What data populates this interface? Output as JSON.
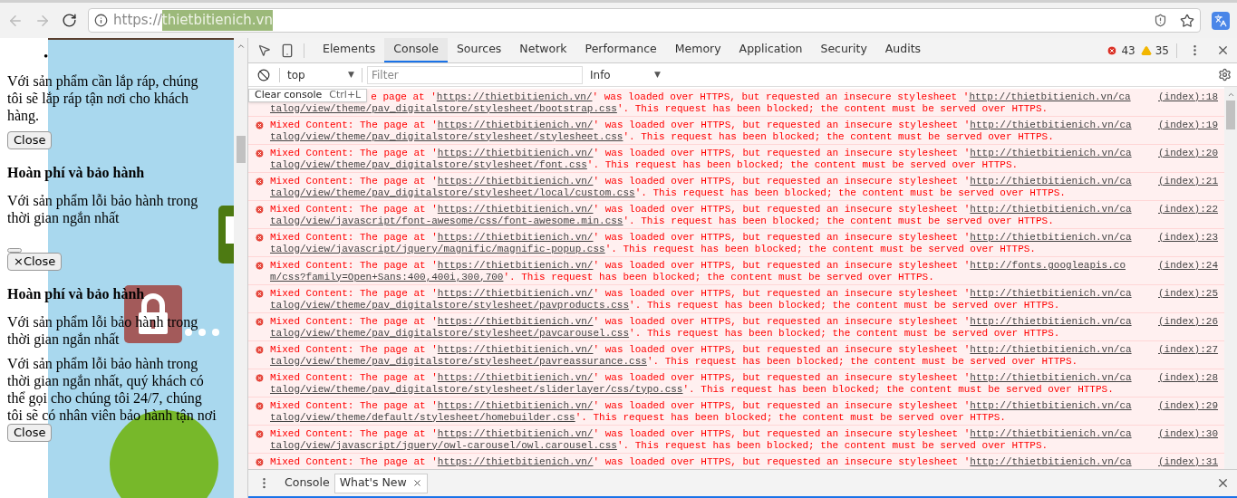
{
  "browser": {
    "url_scheme": "https://",
    "url_host": "thietbitienich.vn"
  },
  "page": {
    "blocks": [
      {
        "kind": "bullet",
        "text": "•"
      },
      {
        "kind": "para",
        "text": "Với sản phẩm cần lắp ráp, chúng tôi sẽ lắp ráp tận nơi cho khách hàng."
      },
      {
        "kind": "button",
        "text": "Close"
      },
      {
        "kind": "heading",
        "text": "Hoàn phí và bảo hành"
      },
      {
        "kind": "para",
        "text": "Với sản phẩm lỗi bảo hành trong thời gian ngắn nhất"
      },
      {
        "kind": "tiny_button"
      },
      {
        "kind": "button",
        "text": "×Close"
      },
      {
        "kind": "heading",
        "text": "Hoàn phí và bảo hành"
      },
      {
        "kind": "para",
        "text": "Với sản phẩm lỗi bảo hành trong thời gian ngắn nhất"
      },
      {
        "kind": "para_tight",
        "text": "Với sản phẩm lỗi bảo hành trong thời gian ngắn nhất, quý khách có thể gọi cho chúng tôi 24/7, chúng tôi sẽ có nhân viên bảo hành tận nơi"
      },
      {
        "kind": "button",
        "text": "Close"
      }
    ]
  },
  "devtools": {
    "tabs": [
      {
        "label": "Elements",
        "selected": false
      },
      {
        "label": "Console",
        "selected": true
      },
      {
        "label": "Sources",
        "selected": false
      },
      {
        "label": "Network",
        "selected": false
      },
      {
        "label": "Performance",
        "selected": false
      },
      {
        "label": "Memory",
        "selected": false
      },
      {
        "label": "Application",
        "selected": false
      },
      {
        "label": "Security",
        "selected": false
      },
      {
        "label": "Audits",
        "selected": false
      }
    ],
    "error_count": "43",
    "warning_count": "35",
    "context": "top",
    "filter_placeholder": "Filter",
    "level": "Info",
    "dropdown_caret": "▼",
    "tooltip": {
      "label": "Clear console",
      "shortcut": "Ctrl+L"
    },
    "messages": [
      {
        "before": "e page at '",
        "page_url": "https://thietbitienich.vn/",
        "middle": "' was loaded over HTTPS, but requested an insecure stylesheet '",
        "res_head": "http://thietbitienich.vn/ca",
        "res_tail": "talog/view/theme/pav_digitalstore/stylesheet/bootstrap.css",
        "after": "'. This request has been blocked; the content must be served over HTTPS.",
        "source": "(index):18",
        "covered": true
      },
      {
        "before": "Mixed Content: The page at '",
        "page_url": "https://thietbitienich.vn/",
        "middle": "' was loaded over HTTPS, but requested an insecure stylesheet '",
        "res_head": "http://thietbitienich.vn/ca",
        "res_tail": "talog/view/theme/pav_digitalstore/stylesheet/stylesheet.css",
        "after": "'. This request has been blocked; the content must be served over HTTPS.",
        "source": "(index):19",
        "covered": false
      },
      {
        "before": "Mixed Content: The page at '",
        "page_url": "https://thietbitienich.vn/",
        "middle": "' was loaded over HTTPS, but requested an insecure stylesheet '",
        "res_head": "http://thietbitienich.vn/ca",
        "res_tail": "talog/view/theme/pav_digitalstore/stylesheet/font.css",
        "after": "'. This request has been blocked; the content must be served over HTTPS.",
        "source": "(index):20",
        "covered": false
      },
      {
        "before": "Mixed Content: The page at '",
        "page_url": "https://thietbitienich.vn/",
        "middle": "' was loaded over HTTPS, but requested an insecure stylesheet '",
        "res_head": "http://thietbitienich.vn/ca",
        "res_tail": "talog/view/theme/pav_digitalstore/stylesheet/local/custom.css",
        "after": "'. This request has been blocked; the content must be served over HTTPS.",
        "source": "(index):21",
        "covered": false
      },
      {
        "before": "Mixed Content: The page at '",
        "page_url": "https://thietbitienich.vn/",
        "middle": "' was loaded over HTTPS, but requested an insecure stylesheet '",
        "res_head": "http://thietbitienich.vn/ca",
        "res_tail": "talog/view/javascript/font-awesome/css/font-awesome.min.css",
        "after": "'. This request has been blocked; the content must be served over HTTPS.",
        "source": "(index):22",
        "covered": false
      },
      {
        "before": "Mixed Content: The page at '",
        "page_url": "https://thietbitienich.vn/",
        "middle": "' was loaded over HTTPS, but requested an insecure stylesheet '",
        "res_head": "http://thietbitienich.vn/ca",
        "res_tail": "talog/view/javascript/jquery/magnific/magnific-popup.css",
        "after": "'. This request has been blocked; the content must be served over HTTPS.",
        "source": "(index):23",
        "covered": false
      },
      {
        "before": "Mixed Content: The page at '",
        "page_url": "https://thietbitienich.vn/",
        "middle": "' was loaded over HTTPS, but requested an insecure stylesheet '",
        "res_head": "http://fonts.googleapis.co",
        "res_tail": "m/css?family=Open+Sans:400,400i,300,700",
        "after": "'. This request has been blocked; the content must be served over HTTPS.",
        "source": "(index):24",
        "covered": false
      },
      {
        "before": "Mixed Content: The page at '",
        "page_url": "https://thietbitienich.vn/",
        "middle": "' was loaded over HTTPS, but requested an insecure stylesheet '",
        "res_head": "http://thietbitienich.vn/ca",
        "res_tail": "talog/view/theme/pav_digitalstore/stylesheet/pavproducts.css",
        "after": "'. This request has been blocked; the content must be served over HTTPS.",
        "source": "(index):25",
        "covered": false
      },
      {
        "before": "Mixed Content: The page at '",
        "page_url": "https://thietbitienich.vn/",
        "middle": "' was loaded over HTTPS, but requested an insecure stylesheet '",
        "res_head": "http://thietbitienich.vn/ca",
        "res_tail": "talog/view/theme/pav_digitalstore/stylesheet/pavcarousel.css",
        "after": "'. This request has been blocked; the content must be served over HTTPS.",
        "source": "(index):26",
        "covered": false
      },
      {
        "before": "Mixed Content: The page at '",
        "page_url": "https://thietbitienich.vn/",
        "middle": "' was loaded over HTTPS, but requested an insecure stylesheet '",
        "res_head": "http://thietbitienich.vn/ca",
        "res_tail": "talog/view/theme/pav_digitalstore/stylesheet/pavreassurance.css",
        "after": "'. This request has been blocked; the content must be served over HTTPS.",
        "source": "(index):27",
        "covered": false
      },
      {
        "before": "Mixed Content: The page at '",
        "page_url": "https://thietbitienich.vn/",
        "middle": "' was loaded over HTTPS, but requested an insecure stylesheet '",
        "res_head": "http://thietbitienich.vn/ca",
        "res_tail": "talog/view/theme/pav_digitalstore/stylesheet/sliderlayer/css/typo.css",
        "after": "'. This request has been blocked; the content must be served over HTTPS.",
        "source": "(index):28",
        "covered": false
      },
      {
        "before": "Mixed Content: The page at '",
        "page_url": "https://thietbitienich.vn/",
        "middle": "' was loaded over HTTPS, but requested an insecure stylesheet '",
        "res_head": "http://thietbitienich.vn/ca",
        "res_tail": "talog/view/theme/default/stylesheet/homebuilder.css",
        "after": "'. This request has been blocked; the content must be served over HTTPS.",
        "source": "(index):29",
        "covered": false
      },
      {
        "before": "Mixed Content: The page at '",
        "page_url": "https://thietbitienich.vn/",
        "middle": "' was loaded over HTTPS, but requested an insecure stylesheet '",
        "res_head": "http://thietbitienich.vn/ca",
        "res_tail": "talog/view/javascript/jquery/owl-carousel/owl.carousel.css",
        "after": "'. This request has been blocked; the content must be served over HTTPS.",
        "source": "(index):30",
        "covered": false
      },
      {
        "before": "Mixed Content: The page at '",
        "page_url": "https://thietbitienich.vn/",
        "middle": "' was loaded over HTTPS, but requested an insecure stylesheet '",
        "res_head": "http://thietbitienich.vn/ca",
        "source": "(index):31",
        "covered": false
      }
    ],
    "drawer_tabs": [
      {
        "label": "Console",
        "selected": false,
        "closable": false
      },
      {
        "label": "What's New",
        "selected": true,
        "closable": true
      }
    ]
  }
}
